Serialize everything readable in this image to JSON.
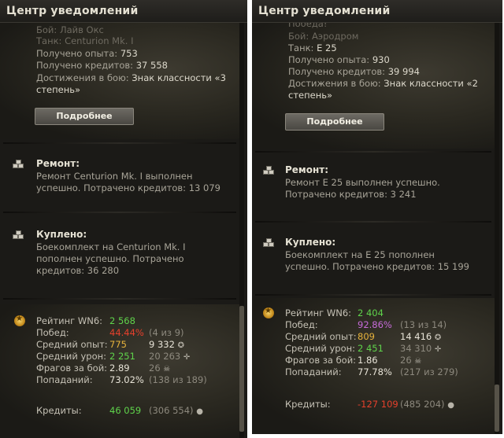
{
  "panels": [
    {
      "title": "Центр уведомлений",
      "battle": {
        "lines": [
          {
            "label": "Бой:",
            "value": "Лайв Окс"
          },
          {
            "label": "Танк:",
            "value": "Centurion Mk. I"
          },
          {
            "label": "Получено опыта:",
            "value": "753"
          },
          {
            "label": "Получено кредитов:",
            "value": "37 558"
          },
          {
            "label": "Достижения в бою:",
            "value": "Знак классности «3"
          },
          {
            "label": "",
            "value": "степень»"
          }
        ],
        "button": "Подробнее"
      },
      "repair": {
        "title": "Ремонт:",
        "line1": "Ремонт Centurion Mk. I выполнен",
        "line2": "успешно. Потрачено кредитов:  13 079"
      },
      "bought": {
        "title": "Куплено:",
        "line1": "Боекомплект на Centurion Mk. I",
        "line2": "пополнен успешно. Потрачено",
        "line3": "кредитов:  36 280"
      },
      "rating": {
        "wn6_label": "Рейтинг WN6:",
        "wn6_value": "2 568",
        "wins_label": "Побед:",
        "wins_value": "44.44%",
        "wins_extra": "(4 из 9)",
        "exp_label": "Средний опыт:",
        "exp_value": "775",
        "exp_extra": "9 332",
        "dmg_label": "Средний урон:",
        "dmg_value": "2 251",
        "dmg_extra": "20 263",
        "frags_label": "Фрагов за бой:",
        "frags_value": "2.89",
        "frags_extra": "26",
        "hits_label": "Попаданий:",
        "hits_value": "73.02%",
        "hits_extra": "(138 из 189)",
        "credits_label": "Кредиты:",
        "credits_value": "46 059",
        "credits_extra": "(306 554)"
      }
    },
    {
      "title": "Центр уведомлений",
      "battle": {
        "lines": [
          {
            "label": "Победа!",
            "value": ""
          },
          {
            "label": "Бой:",
            "value": "Аэродром"
          },
          {
            "label": "Танк:",
            "value": "E 25"
          },
          {
            "label": "Получено опыта:",
            "value": "930"
          },
          {
            "label": "Получено кредитов:",
            "value": "39 994"
          },
          {
            "label": "Достижения в бою:",
            "value": "Знак классности «2"
          },
          {
            "label": "",
            "value": "степень»"
          }
        ],
        "button": "Подробнее"
      },
      "repair": {
        "title": "Ремонт:",
        "line1": "Ремонт E 25 выполнен успешно.",
        "line2": "Потрачено кредитов:  3 241"
      },
      "bought": {
        "title": "Куплено:",
        "line1": "Боекомплект на E 25 пополнен",
        "line2": "успешно. Потрачено кредитов:  15 199",
        "line3": ""
      },
      "rating": {
        "wn6_label": "Рейтинг WN6:",
        "wn6_value": "2 404",
        "wins_label": "Побед:",
        "wins_value": "92.86%",
        "wins_extra": "(13 из 14)",
        "exp_label": "Средний опыт:",
        "exp_value": "809",
        "exp_extra": "14 416",
        "dmg_label": "Средний урон:",
        "dmg_value": "2 451",
        "dmg_extra": "34 310",
        "frags_label": "Фрагов за бой:",
        "frags_value": "1.86",
        "frags_extra": "26",
        "hits_label": "Попаданий:",
        "hits_value": "77.78%",
        "hits_extra": "(217 из 279)",
        "credits_label": "Кредиты:",
        "credits_value": "-127 109",
        "credits_extra": "(485 204)"
      }
    }
  ],
  "colors": {
    "wn6": "#5fd34b",
    "wins_left": "#e5402c",
    "wins_right": "#c66bd8",
    "exp": "#e7b33c",
    "dmg": "#5fd34b",
    "credits_left": "#5fd34b",
    "credits_right": "#e5402c"
  }
}
